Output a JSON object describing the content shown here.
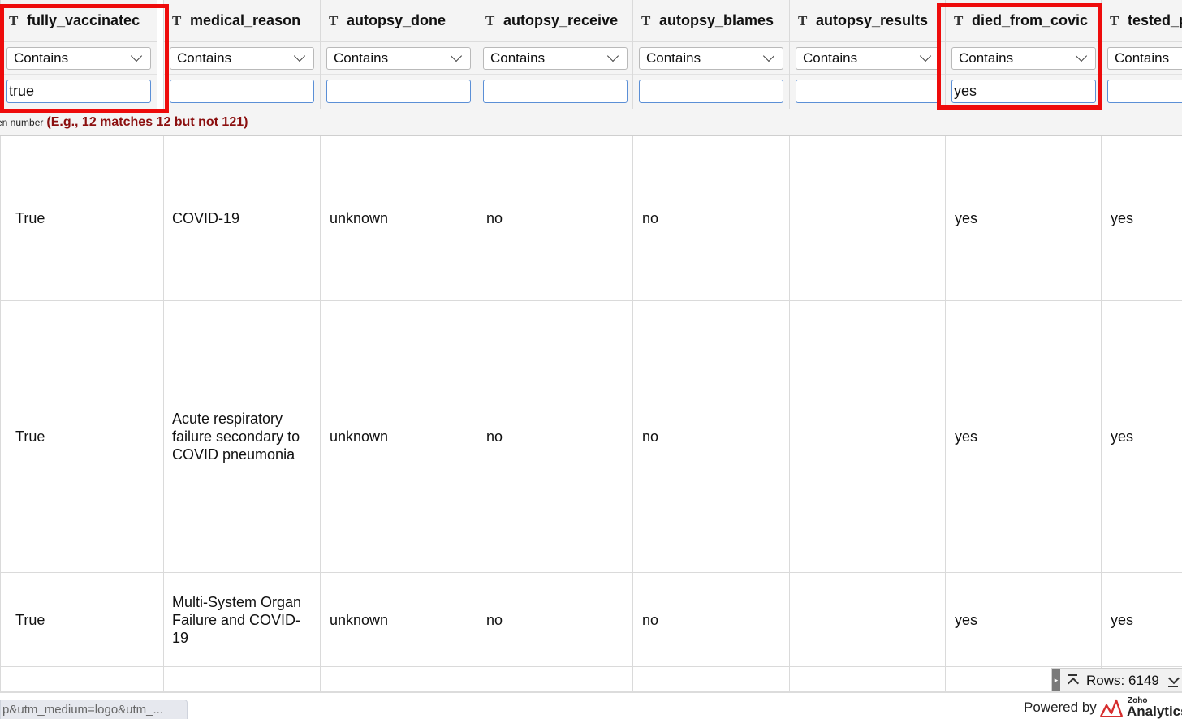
{
  "columns": [
    {
      "type_icon": "T",
      "name": "fully_vaccinatec",
      "operator": "Contains",
      "filter_value": "true"
    },
    {
      "type_icon": "T",
      "name": "medical_reason",
      "operator": "Contains",
      "filter_value": ""
    },
    {
      "type_icon": "T",
      "name": "autopsy_done",
      "operator": "Contains",
      "filter_value": ""
    },
    {
      "type_icon": "T",
      "name": "autopsy_receive",
      "operator": "Contains",
      "filter_value": ""
    },
    {
      "type_icon": "T",
      "name": "autopsy_blames",
      "operator": "Contains",
      "filter_value": ""
    },
    {
      "type_icon": "T",
      "name": "autopsy_results",
      "operator": "Contains",
      "filter_value": ""
    },
    {
      "type_icon": "T",
      "name": "died_from_covic",
      "operator": "Contains",
      "filter_value": "yes"
    },
    {
      "type_icon": "T",
      "name": "tested_p",
      "operator": "Contains",
      "filter_value": ""
    }
  ],
  "hint": {
    "prefix": "en number",
    "text": "(E.g., 12 matches 12 but not 121)"
  },
  "rows": [
    [
      "True",
      "COVID-19",
      "unknown",
      "no",
      "no",
      "",
      "yes",
      "yes"
    ],
    [
      "True",
      "Acute respiratory failure secondary to COVID pneumonia",
      "unknown",
      "no",
      "no",
      "",
      "yes",
      "yes"
    ],
    [
      "True",
      "Multi-System Organ Failure and COVID-19",
      "unknown",
      "no",
      "no",
      "",
      "yes",
      "yes"
    ],
    [
      "",
      "",
      "",
      "",
      "",
      "",
      "",
      ""
    ]
  ],
  "row_count": "Rows: 6149",
  "footer": {
    "status_url": "p&utm_medium=logo&utm_...",
    "powered_by": "Powered by",
    "logo_small": "Zoho",
    "logo_text": "Analytics"
  },
  "colors": {
    "highlight": "#ee0b0b",
    "hint_text": "#8b0f0f",
    "input_border": "#5b8fd6"
  }
}
